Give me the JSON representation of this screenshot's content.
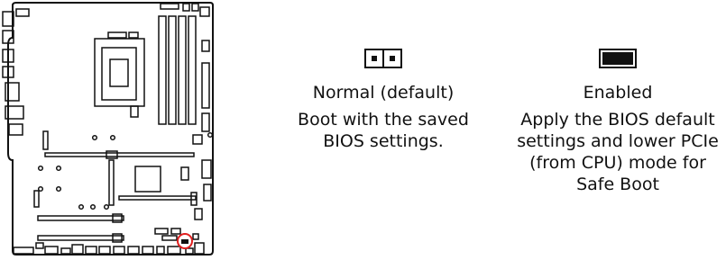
{
  "states": [
    {
      "jumper": "open",
      "title": "Normal (default)",
      "desc_lines": [
        "Boot with the saved",
        "BIOS settings."
      ]
    },
    {
      "jumper": "closed",
      "title": "Enabled",
      "desc_lines": [
        "Apply the BIOS default",
        "settings and lower PCIe",
        "(from CPU) mode for",
        "Safe Boot"
      ]
    }
  ],
  "colors": {
    "line": "#111111",
    "highlight": "#e02020"
  }
}
